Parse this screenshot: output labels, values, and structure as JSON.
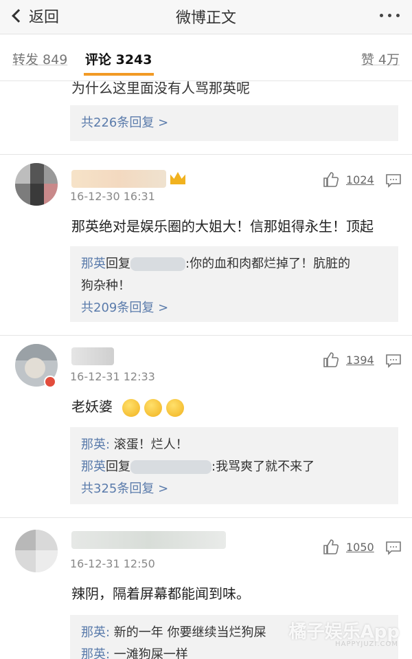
{
  "nav": {
    "back_label": "返回",
    "title": "微博正文"
  },
  "tabs": {
    "repost": "转发 849",
    "comments": "评论 3243",
    "likes": "赞 4万"
  },
  "top_comment": {
    "text": "为什么这里面没有人骂那英呢",
    "more_replies": "共226条回复 >"
  },
  "comments": [
    {
      "timestamp": "16-12-30 16:31",
      "likes": "1024",
      "text": "那英绝对是娱乐圈的大姐大！信那姐得永生！顶起",
      "reply_nick": "那英",
      "reply_action": "回复",
      "reply_text": ":你的血和肉都烂掉了！肮脏的",
      "reply_text2": "狗杂种！",
      "more_replies": "共209条回复 >"
    },
    {
      "timestamp": "16-12-31 12:33",
      "likes": "1394",
      "text": "老妖婆",
      "reply1_nick": "那英:",
      "reply1_text": " 滚蛋！烂人！",
      "reply2_nick": "那英",
      "reply2_action": "回复",
      "reply2_text": ":我骂爽了就不来了",
      "more_replies": "共325条回复 >"
    },
    {
      "timestamp": "16-12-31 12:50",
      "likes": "1050",
      "text": "辣阴，隔着屏幕都能闻到味。",
      "reply1_nick": "那英:",
      "reply1_text": " 新的一年 你要继续当烂狗屎",
      "reply2_nick": "那英:",
      "reply2_text": " 一滩狗屎一样"
    }
  ],
  "watermark": {
    "main": "橘子娱乐App",
    "sub": "HAPPYJUZI.COM"
  },
  "colors": {
    "accent": "#f29a25",
    "link": "#5a7bab",
    "reply_bg": "#f2f2f2"
  }
}
